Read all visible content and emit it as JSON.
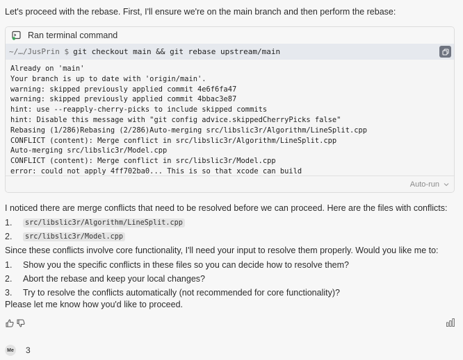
{
  "intro_text": "Let's proceed with the rebase. First, I'll ensure we're on the main branch and then perform the rebase:",
  "terminal": {
    "header_label": "Ran terminal command",
    "path": "~/…/JusPrin $",
    "command": "git checkout main && git rebase upstream/main",
    "output_lines": [
      "Already on 'main'",
      "Your branch is up to date with 'origin/main'.",
      "warning: skipped previously applied commit 4e6f6fa47",
      "warning: skipped previously applied commit 4bbac3e87",
      "hint: use --reapply-cherry-picks to include skipped commits",
      "hint: Disable this message with \"git config advice.skippedCherryPicks false\"",
      "Rebasing (1/286)Rebasing (2/286)Auto-merging src/libslic3r/Algorithm/LineSplit.cpp",
      "CONFLICT (content): Merge conflict in src/libslic3r/Algorithm/LineSplit.cpp",
      "Auto-merging src/libslic3r/Model.cpp",
      "CONFLICT (content): Merge conflict in src/libslic3r/Model.cpp",
      "error: could not apply 4ff702ba0... This is so that xcode can build"
    ],
    "footer_label": "Auto-run"
  },
  "conflict_intro": "I noticed there are merge conflicts that need to be resolved before we can proceed. Here are the files with conflicts:",
  "conflict_files": [
    {
      "num": "1.",
      "file": "src/libslic3r/Algorithm/LineSplit.cpp"
    },
    {
      "num": "2.",
      "file": "src/libslic3r/Model.cpp"
    }
  ],
  "question": "Since these conflicts involve core functionality, I'll need your input to resolve them properly. Would you like me to:",
  "options": [
    {
      "num": "1.",
      "text": "Show you the specific conflicts in these files so you can decide how to resolve them?"
    },
    {
      "num": "2.",
      "text": "Abort the rebase and keep your local changes?"
    },
    {
      "num": "3.",
      "text": "Try to resolve the conflicts automatically (not recommended for core functionality)?"
    }
  ],
  "closing": "Please let me know how you'd like to proceed.",
  "user": {
    "avatar": "Me",
    "count": "3"
  },
  "icons": {
    "terminal": "terminal-icon",
    "copy": "copy-icon",
    "thumbs_up": "thumbs-up-icon",
    "thumbs_down": "thumbs-down-icon",
    "bars": "bar-chart-icon",
    "chevron": "chevron-down-icon"
  }
}
